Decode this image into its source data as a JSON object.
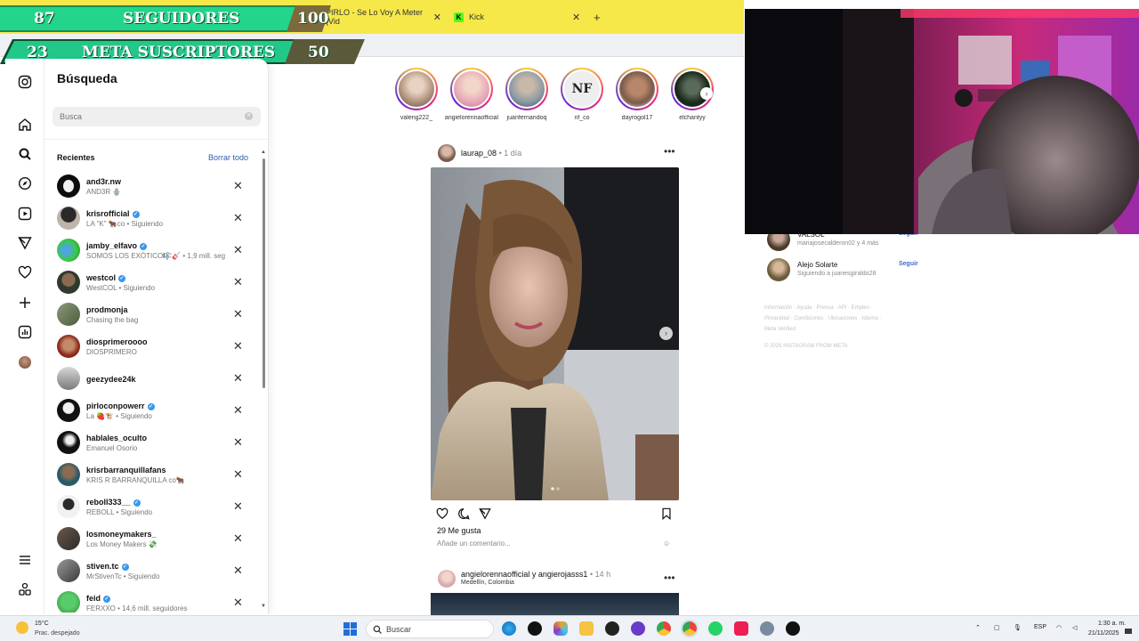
{
  "overlay": {
    "followers_count": "87",
    "followers_label": "SEGUIDORES",
    "followers_goal": "100",
    "subs_count": "23",
    "subs_label": "META SUSCRIPTORES",
    "subs_goal": "50"
  },
  "browser": {
    "tabs": [
      {
        "title": "PIRLO - Se Lo Voy A Meter (Vid"
      },
      {
        "title": "Kick"
      }
    ],
    "new_tab": "+",
    "close_glyph": "✕"
  },
  "search_panel": {
    "title": "Búsqueda",
    "placeholder": "Busca",
    "recents_label": "Recientes",
    "clear_all": "Borrar todo",
    "items": [
      {
        "username": "and3r.nw",
        "sub": "AND3R 🪬",
        "verified": false
      },
      {
        "username": "krisrofficial",
        "sub": "LA \"K\" 🐂co • Siguiendo",
        "verified": true
      },
      {
        "username": "jamby_elfavo",
        "sub": "SOMOS LOS EXÓTICO🎼🎸 • 1,9 mill. seg",
        "verified": true
      },
      {
        "username": "westcol",
        "sub": "WestCOL • Siguiendo",
        "verified": true
      },
      {
        "username": "prodmonja",
        "sub": "Chasing the bag",
        "verified": false
      },
      {
        "username": "diosprimeroooo",
        "sub": "DIOSPRIMERO",
        "verified": false
      },
      {
        "username": "geezydee24k",
        "sub": "",
        "verified": false
      },
      {
        "username": "pirloconpowerr",
        "sub": "La 🍓🐮 • Siguiendo",
        "verified": true
      },
      {
        "username": "hablales_oculto",
        "sub": "Emanuel Osorio",
        "verified": false
      },
      {
        "username": "krisrbarranquillafans",
        "sub": "KRIS R BARRANQUILLA co🐂",
        "verified": false
      },
      {
        "username": "reboll333__",
        "sub": "REBOLL • Siguiendo",
        "verified": true
      },
      {
        "username": "losmoneymakers_",
        "sub": "Los Money Makers 💸",
        "verified": false
      },
      {
        "username": "stiven.tc",
        "sub": "MrStivenTc • Siguiendo",
        "verified": true
      },
      {
        "username": "feid",
        "sub": "FERXXO • 14,6 mill. seguidores",
        "verified": true
      }
    ]
  },
  "stories": [
    {
      "name": "valeng222_",
      "color": "#b89a86"
    },
    {
      "name": "angielorennaofficial",
      "color": "#d8b2a0"
    },
    {
      "name": "juanfernandoq",
      "color": "#8b9aa3"
    },
    {
      "name": "nf_co",
      "color": "#333333"
    },
    {
      "name": "dayrogol17",
      "color": "#7a5a4a"
    },
    {
      "name": "elchantyy",
      "color": "#2a3a2a"
    }
  ],
  "post": {
    "username": "laurap_08",
    "time": "• 1 día",
    "likes": "29 Me gusta",
    "comment_placeholder": "Añade un comentario...",
    "menu": "•••"
  },
  "post2": {
    "users": "angielorennaofficial y angierojasss1",
    "time": "• 14 h",
    "location": "Medellín, Colombia",
    "menu": "•••"
  },
  "suggestions": [
    {
      "name": "VALSOL",
      "detail": "mariajosecalderon02 y 4 más",
      "follow": "Seguir"
    },
    {
      "name": "Alejo Solarte",
      "detail": "Siguiendo a juanesgiraldo28",
      "follow": "Seguir"
    }
  ],
  "footer": {
    "links1": "Información · Ayuda · Prensa · API · Empleo ·",
    "links2": "Privacidad · Condiciones · Ubicaciones · Idioma ·",
    "links3": "Meta Verified",
    "copyright": "© 2025 INSTAGRAM FROM META"
  },
  "taskbar": {
    "temperature": "15°C",
    "weather": "Prac. despejado",
    "search": "Buscar",
    "lang": "ESP",
    "time": "1:30 a. m.",
    "date": "21/11/2025"
  },
  "colors": {
    "accent_link": "#2a5db0",
    "overlay_green": "#22d58a",
    "overlay_yellow": "#f7e84a"
  }
}
